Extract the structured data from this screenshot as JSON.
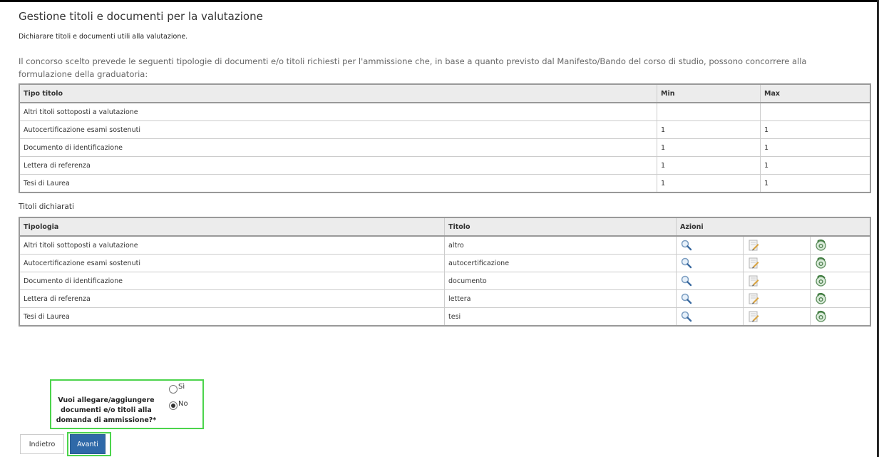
{
  "header": {
    "title": "Gestione titoli e documenti per la valutazione",
    "subtitle": "Dichiarare titoli e documenti utili alla valutazione.",
    "intro": "Il concorso scelto prevede le seguenti tipologie di documenti e/o titoli richiesti per l'ammissione che, in base a quanto previsto dal Manifesto/Bando del corso di studio, possono concorrere alla formulazione della graduatoria:"
  },
  "required_table": {
    "headers": [
      "Tipo titolo",
      "Min",
      "Max"
    ],
    "rows": [
      {
        "tipo": "Altri titoli sottoposti a valutazione",
        "min": "",
        "max": ""
      },
      {
        "tipo": "Autocertificazione esami sostenuti",
        "min": "1",
        "max": "1"
      },
      {
        "tipo": "Documento di identificazione",
        "min": "1",
        "max": "1"
      },
      {
        "tipo": "Lettera di referenza",
        "min": "1",
        "max": "1"
      },
      {
        "tipo": "Tesi di Laurea",
        "min": "1",
        "max": "1"
      }
    ]
  },
  "declared": {
    "section_label": "Titoli dichiarati",
    "headers": [
      "Tipologia",
      "Titolo",
      "Azioni"
    ],
    "rows": [
      {
        "tipologia": "Altri titoli sottoposti a valutazione",
        "titolo": "altro"
      },
      {
        "tipologia": "Autocertificazione esami sostenuti",
        "titolo": "autocertificazione"
      },
      {
        "tipologia": "Documento di identificazione",
        "titolo": "documento"
      },
      {
        "tipologia": "Lettera di referenza",
        "titolo": "lettera"
      },
      {
        "tipologia": "Tesi di Laurea",
        "titolo": "tesi"
      }
    ],
    "action_icons": [
      "view-icon",
      "edit-icon",
      "delete-icon"
    ]
  },
  "question": {
    "label": "Vuoi allegare/aggiungere documenti e/o titoli alla domanda di ammissione?*",
    "options": [
      {
        "label": "Sì",
        "checked": false
      },
      {
        "label": "No",
        "checked": true
      }
    ]
  },
  "buttons": {
    "back": "Indietro",
    "next": "Avanti"
  },
  "colors": {
    "highlight": "#4cd44c",
    "primary_button": "#2f69a8"
  }
}
